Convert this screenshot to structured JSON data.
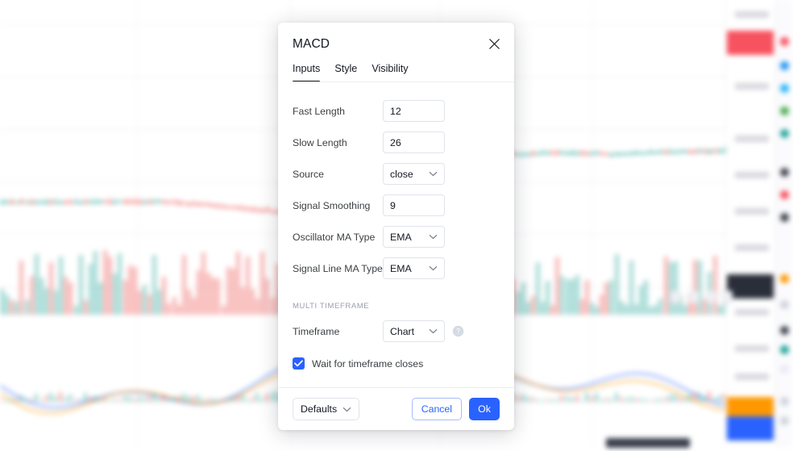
{
  "dialog": {
    "title": "MACD",
    "close_icon": "close-icon",
    "tabs": [
      {
        "label": "Inputs",
        "active": true
      },
      {
        "label": "Style",
        "active": false
      },
      {
        "label": "Visibility",
        "active": false
      }
    ],
    "fields": [
      {
        "label": "Fast Length",
        "type": "text",
        "value": "12"
      },
      {
        "label": "Slow Length",
        "type": "text",
        "value": "26"
      },
      {
        "label": "Source",
        "type": "select",
        "value": "close"
      },
      {
        "label": "Signal Smoothing",
        "type": "text",
        "value": "9"
      },
      {
        "label": "Oscillator MA Type",
        "type": "select",
        "value": "EMA"
      },
      {
        "label": "Signal Line MA Type",
        "type": "select",
        "value": "EMA"
      }
    ],
    "section": {
      "label": "MULTI TIMEFRAME",
      "timeframe_label": "Timeframe",
      "timeframe_value": "Chart",
      "help_icon": "help-circle-icon",
      "checkbox_label": "Wait for timeframe closes",
      "checkbox_checked": true
    },
    "footer": {
      "defaults_label": "Defaults",
      "cancel_label": "Cancel",
      "ok_label": "Ok"
    }
  },
  "colors": {
    "accent_blue": "#2962ff",
    "text_primary": "#131722",
    "text_secondary": "#3c4043",
    "muted": "#9aa0ab",
    "border": "#e0e3eb",
    "candle_up": "#26a69a",
    "candle_down": "#ef5350",
    "badge_red": "#f7525f",
    "badge_dark": "#2a2e39"
  },
  "background": {
    "description": "blurred-trading-chart"
  }
}
